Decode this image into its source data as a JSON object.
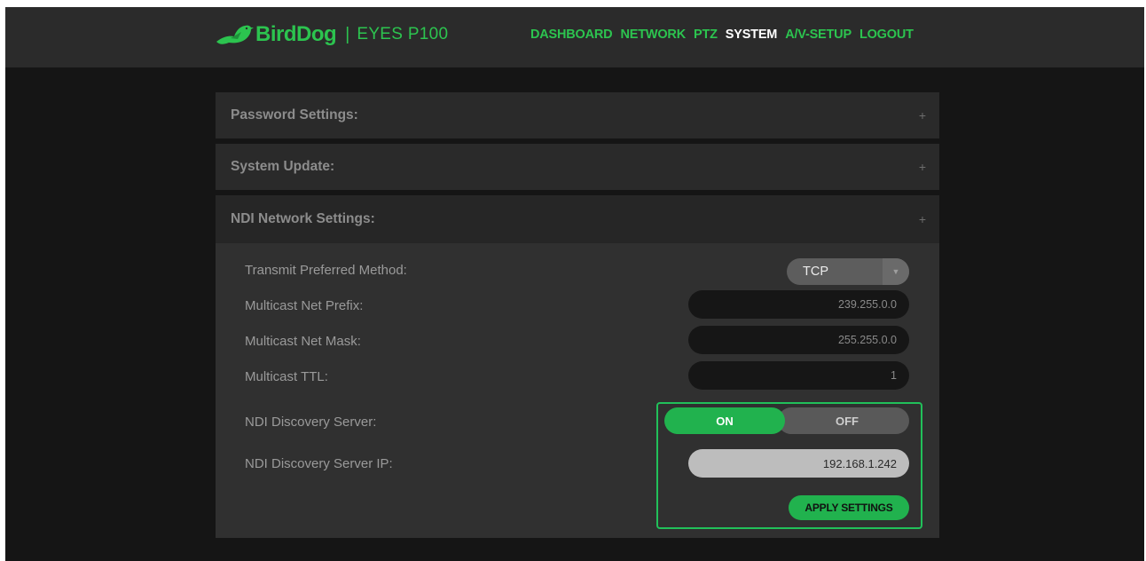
{
  "header": {
    "brand": "BirdDog",
    "separator": "|",
    "model": "EYES P100",
    "nav": [
      {
        "label": "DASHBOARD",
        "active": false
      },
      {
        "label": "NETWORK",
        "active": false
      },
      {
        "label": "PTZ",
        "active": false
      },
      {
        "label": "SYSTEM",
        "active": true
      },
      {
        "label": "A/V-SETUP",
        "active": false
      },
      {
        "label": "LOGOUT",
        "active": false
      }
    ]
  },
  "panels": {
    "password": {
      "title": "Password Settings:",
      "icon": "+"
    },
    "update": {
      "title": "System Update:",
      "icon": "+"
    },
    "ndi": {
      "title": "NDI Network Settings:",
      "icon": "+",
      "transmit_label": "Transmit Preferred Method:",
      "transmit_value": "TCP",
      "dropdown_arrow": "▼",
      "prefix_label": "Multicast Net Prefix:",
      "prefix_value": "239.255.0.0",
      "mask_label": "Multicast Net Mask:",
      "mask_value": "255.255.0.0",
      "ttl_label": "Multicast TTL:",
      "ttl_value": "1",
      "discovery_label": "NDI Discovery Server:",
      "discovery_on": "ON",
      "discovery_off": "OFF",
      "discovery_state": "ON",
      "discovery_ip_label": "NDI Discovery Server IP:",
      "discovery_ip_value": "192.168.1.242",
      "apply_label": "APPLY SETTINGS"
    }
  },
  "colors": {
    "accent": "#2cc44f",
    "toggle_on": "#21b24e",
    "highlight_border": "#21c05a"
  }
}
